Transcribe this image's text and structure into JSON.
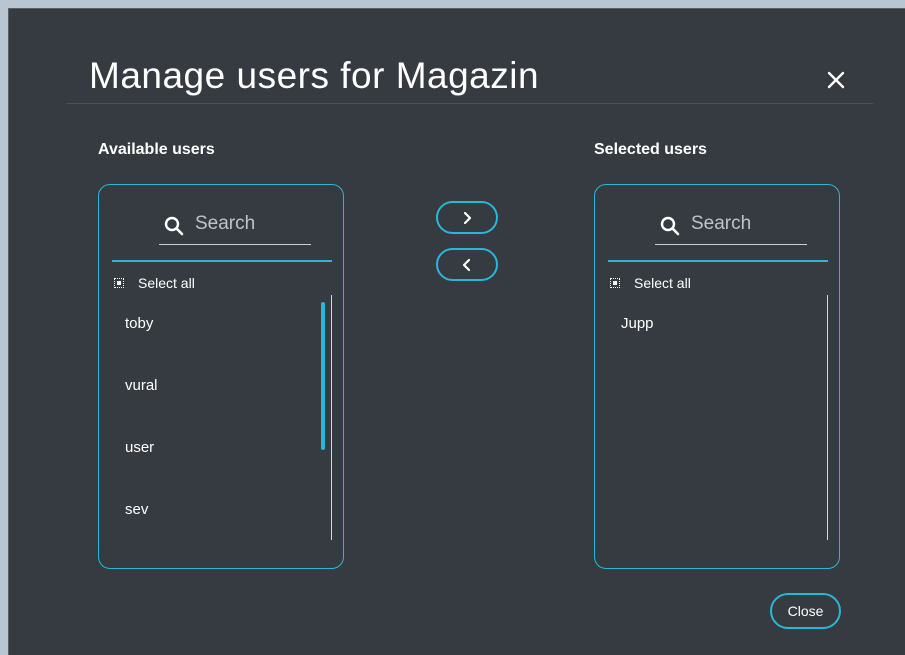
{
  "dialog": {
    "title": "Manage users for Magazin",
    "close_label": "Close"
  },
  "available": {
    "heading": "Available users",
    "search_placeholder": "Search",
    "select_all_label": "Select all",
    "items": [
      "toby",
      "vural",
      "user",
      "sev"
    ]
  },
  "selected": {
    "heading": "Selected users",
    "search_placeholder": "Search",
    "select_all_label": "Select all",
    "items": [
      "Jupp"
    ]
  },
  "controls": {
    "move_right_icon": "chevron-right-icon",
    "move_left_icon": "chevron-left-icon"
  },
  "colors": {
    "accent": "#29b6d8",
    "background": "#363b41"
  }
}
